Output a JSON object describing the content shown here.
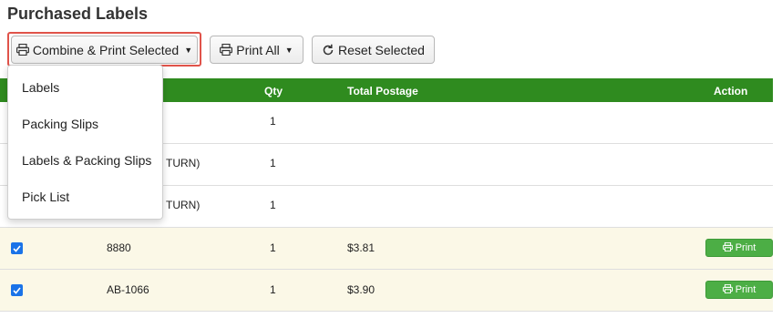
{
  "page": {
    "title": "Purchased Labels"
  },
  "toolbar": {
    "combine_label": "Combine & Print Selected",
    "print_all_label": "Print All",
    "reset_label": "Reset Selected"
  },
  "dropdown": {
    "items": [
      {
        "label": "Labels"
      },
      {
        "label": "Packing Slips"
      },
      {
        "label": "Labels & Packing Slips"
      },
      {
        "label": "Pick List"
      }
    ]
  },
  "table": {
    "headers": {
      "qty": "Qty",
      "total": "Total Postage",
      "action": "Action"
    },
    "rows": [
      {
        "checked": false,
        "order": "",
        "qty": "1",
        "total": "",
        "print": ""
      },
      {
        "checked": false,
        "order": "TURN)",
        "qty": "1",
        "total": "",
        "print": ""
      },
      {
        "checked": false,
        "order": "TURN)",
        "qty": "1",
        "total": "",
        "print": ""
      },
      {
        "checked": true,
        "order": "8880",
        "qty": "1",
        "total": "$3.81",
        "print": "Print"
      },
      {
        "checked": true,
        "order": "AB-1066",
        "qty": "1",
        "total": "$3.90",
        "print": "Print"
      }
    ]
  },
  "colors": {
    "header_green": "#2f8b1f",
    "print_green": "#4cae45",
    "highlight_red": "#e0534a",
    "selected_row": "#fbf8e7",
    "checkbox_blue": "#1a73e8"
  },
  "icons": [
    "printer-icon",
    "caret-down-icon",
    "reset-icon",
    "check-icon"
  ]
}
